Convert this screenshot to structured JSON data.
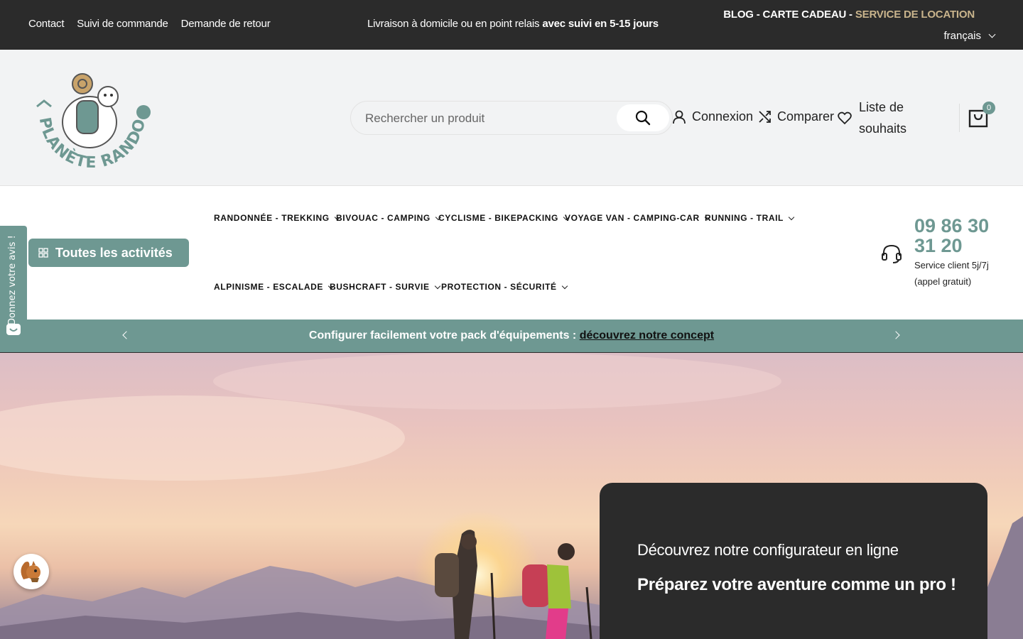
{
  "topbar": {
    "links": [
      "Contact",
      "Suivi de commande",
      "Demande de retour"
    ],
    "shipping_text": "Livraison à domicile ou en point relais",
    "shipping_bold": "avec suivi en 5-15 jours",
    "right_links": "BLOG - CARTE CADEAU - ",
    "location_link": "SERVICE DE LOCATION",
    "language": "français"
  },
  "header": {
    "logo_text": "PLANÈTE RANDO",
    "search_placeholder": "Rechercher un produit",
    "login": "Connexion",
    "compare": "Comparer",
    "wishlist": "Liste de souhaits",
    "cart_count": "0"
  },
  "nav": {
    "all_activities": "Toutes les activités",
    "items": [
      "RANDONNÉE - TREKKING",
      "BIVOUAC - CAMPING",
      "CYCLISME - BIKEPACKING",
      "VOYAGE VAN - CAMPING-CAR",
      "RUNNING - TRAIL",
      "ALPINISME - ESCALADE",
      "BUSHCRAFT - SURVIE",
      "PROTECTION - SÉCURITÉ"
    ],
    "phone": "09 86 30 31 20",
    "phone_sub": "Service client 5j/7j (appel gratuit)"
  },
  "promo": {
    "text": "Configurer facilement votre pack d'équipements : ",
    "link": "découvrez notre concept"
  },
  "hero": {
    "line1": "Découvrez notre configurateur en ligne",
    "line2": "Préparez votre aventure comme un pro !"
  },
  "review_tab": "Donnez votre avis !",
  "colors": {
    "accent": "#6e9892",
    "dark": "#2b2b2b",
    "gold": "#c9b48c"
  }
}
